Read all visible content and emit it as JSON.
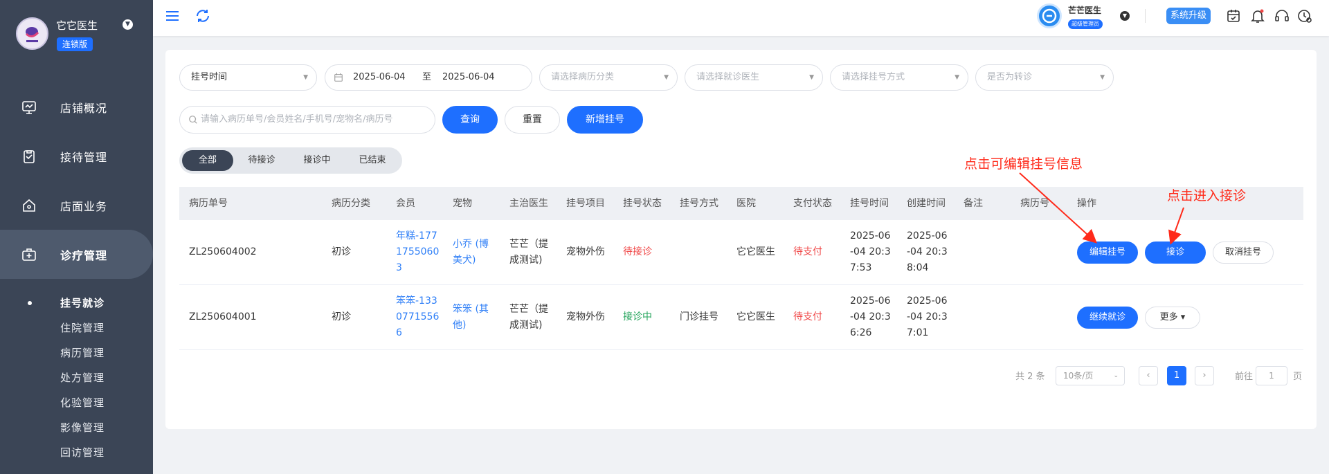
{
  "brand": {
    "name": "它它医生",
    "edition": "连锁版"
  },
  "sidebar": {
    "items": [
      {
        "label": "店铺概况",
        "icon": "monitor-icon"
      },
      {
        "label": "接待管理",
        "icon": "clipboard-icon"
      },
      {
        "label": "店面业务",
        "icon": "house-icon"
      },
      {
        "label": "诊疗管理",
        "icon": "medical-kit-icon"
      }
    ],
    "subitems": [
      "挂号就诊",
      "住院管理",
      "病历管理",
      "处方管理",
      "化验管理",
      "影像管理",
      "回访管理"
    ]
  },
  "header": {
    "user_name": "芒芒医生",
    "user_role": "超级管理员",
    "upgrade_label": "系统升级"
  },
  "filters": {
    "time_type": "挂号时间",
    "date_start": "2025-06-04",
    "date_sep": "至",
    "date_end": "2025-06-04",
    "record_category_placeholder": "请选择病历分类",
    "doctor_placeholder": "请选择就诊医生",
    "reg_method_placeholder": "请选择挂号方式",
    "transfer_placeholder": "是否为转诊",
    "search_placeholder": "请输入病历单号/会员姓名/手机号/宠物名/病历号",
    "query_label": "查询",
    "reset_label": "重置",
    "add_label": "新增挂号"
  },
  "tabs": [
    "全部",
    "待接诊",
    "接诊中",
    "已结束"
  ],
  "table": {
    "headers": [
      "病历单号",
      "病历分类",
      "会员",
      "宠物",
      "主治医生",
      "挂号项目",
      "挂号状态",
      "挂号方式",
      "医院",
      "支付状态",
      "挂号时间",
      "创建时间",
      "备注",
      "病历号",
      "操作"
    ],
    "rows": [
      {
        "record_no": "ZL250604002",
        "category": "初诊",
        "member": [
          "年糕-177",
          "1755060",
          "3"
        ],
        "pet": [
          "小乔 (博",
          "美犬)"
        ],
        "doctor": [
          "芒芒（提",
          "成测试)"
        ],
        "item": "宠物外伤",
        "status": "待接诊",
        "method": "",
        "hospital": "它它医生",
        "pay_status": "待支付",
        "reg_time": [
          "2025-06",
          "-04 20:3",
          "7:53"
        ],
        "create_time": [
          "2025-06",
          "-04 20:3",
          "8:04"
        ],
        "actions": [
          "编辑挂号",
          "接诊",
          "取消挂号"
        ]
      },
      {
        "record_no": "ZL250604001",
        "category": "初诊",
        "member": [
          "笨笨-133",
          "0771556",
          "6"
        ],
        "pet": [
          "笨笨 (其",
          "他)"
        ],
        "doctor": [
          "芒芒（提",
          "成测试)"
        ],
        "item": "宠物外伤",
        "status": "接诊中",
        "method": "门诊挂号",
        "hospital": "它它医生",
        "pay_status": "待支付",
        "reg_time": [
          "2025-06",
          "-04 20:3",
          "6:26"
        ],
        "create_time": [
          "2025-06",
          "-04 20:3",
          "7:01"
        ],
        "actions": [
          "继续就诊",
          "更多 ▾"
        ]
      }
    ]
  },
  "pagination": {
    "total": "共 2 条",
    "page_size": "10条/页",
    "prev": "‹",
    "current": "1",
    "next": "›",
    "goto_label": "前往",
    "goto_value": "1",
    "page_suffix": "页"
  },
  "annotations": {
    "edit_hint": "点击可编辑挂号信息",
    "receive_hint": "点击进入接诊",
    "color": "#ff2a1a"
  },
  "colors": {
    "primary": "#1e6fff",
    "sidebar": "#3b4556",
    "danger": "#f04848",
    "success": "#22a35a"
  }
}
